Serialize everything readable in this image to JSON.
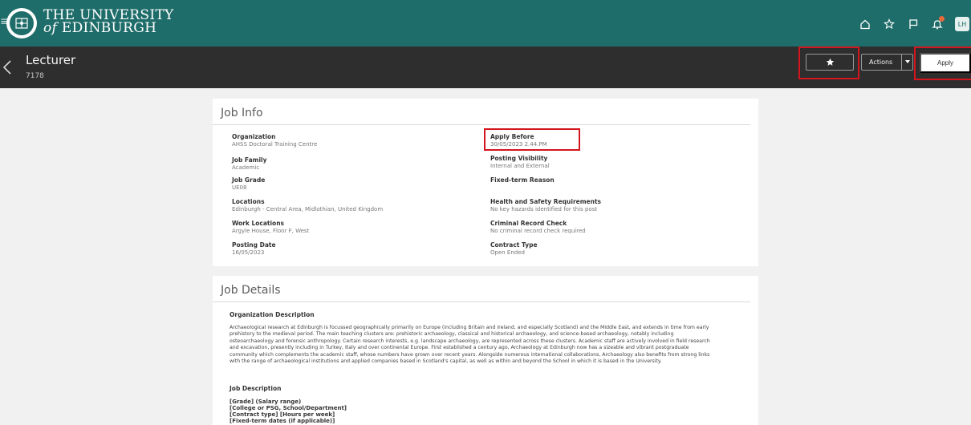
{
  "brand": {
    "name_line1": "THE UNIVERSITY",
    "name_of": "of",
    "name_line2": "EDINBURGH",
    "color": "#1f6d6a"
  },
  "header_icons": [
    "home-icon",
    "star-icon",
    "flag-icon",
    "bell-icon"
  ],
  "user": {
    "initials": "LH"
  },
  "page": {
    "title": "Lecturer",
    "subtitle": "7178"
  },
  "toolbar": {
    "favorite_icon": "star-icon",
    "actions_label": "Actions",
    "apply_label": "Apply",
    "highlight_color": "#d4151d"
  },
  "job_info": {
    "title": "Job Info",
    "left": [
      {
        "label": "Organization",
        "value": "AHSS Doctoral Training Centre"
      },
      {
        "label": "Job Family",
        "value": "Academic"
      },
      {
        "label": "Job Grade",
        "value": "UE08"
      },
      {
        "label": "Locations",
        "value": "Edinburgh - Central Area, Midlothian, United Kingdom"
      },
      {
        "label": "Work Locations",
        "value": "Argyle House, Floor F, West"
      },
      {
        "label": "Posting Date",
        "value": "16/05/2023"
      }
    ],
    "right": [
      {
        "label": "Apply Before",
        "value": "30/05/2023 2.44.PM"
      },
      {
        "label": "Posting Visibility",
        "value": "Internal and External"
      },
      {
        "label": "Fixed-term Reason",
        "value": ""
      },
      {
        "label": "Health and Safety Requirements",
        "value": "No key hazards identified for this post"
      },
      {
        "label": "Criminal Record Check",
        "value": "No criminal record check required"
      },
      {
        "label": "Contract Type",
        "value": "Open Ended"
      }
    ]
  },
  "job_details": {
    "title": "Job Details",
    "org_desc_label": "Organization Description",
    "org_desc_lines": [
      "Archaeological research at Edinburgh is focussed geographically primarily on Europe (including Britain and Ireland, and especially Scotland) and the Middle East, and extends in time from early",
      "prehistory to the medieval period. The main teaching clusters are: prehistoric archaeology, classical and historical archaeology, and science-based archaeology, notably including",
      "osteoarchaeology and forensic anthropology. Certain research interests, e.g. landscape archaeology, are represented across these clusters. Academic staff are actively involved in field research",
      "and excavation, presently including in Turkey, Italy and over continental Europe.  First established a century ago, Archaeology at Edinburgh now has a sizeable and vibrant postgraduate",
      "community which complements the academic staff, whose numbers have grown over recent years.  Alongside numerous international collaborations, Archaeology also benefits from strong links",
      "with the range of archaeological institutions and applied companies based in Scotland's capital, as well as within and beyond the School in which it is based in the University."
    ],
    "job_desc_label": "Job Description",
    "job_desc_lines": [
      "[Grade] (Salary range)",
      "[College or PSG, School/Department]",
      "[Contract type] [Hours per week]",
      "[Fixed-term dates (if applicable)]"
    ]
  }
}
